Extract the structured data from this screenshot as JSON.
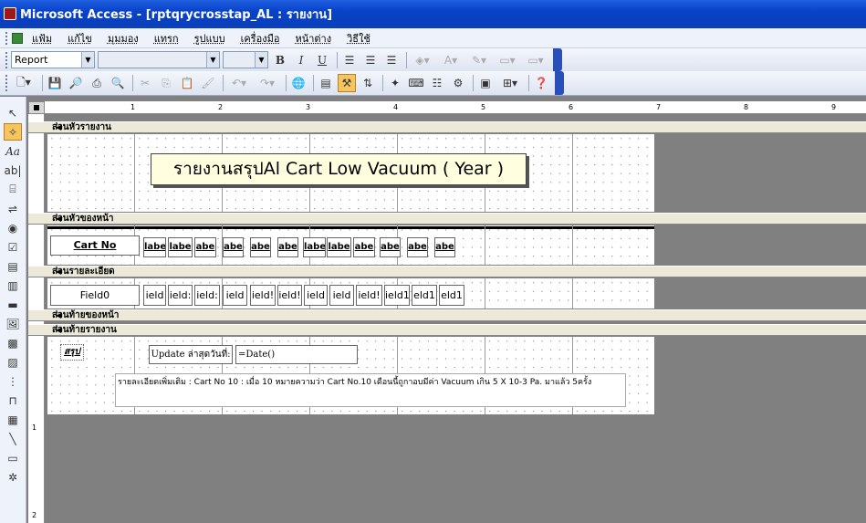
{
  "window": {
    "title": "Microsoft Access - [rptqrycrosstap_AL : รายงาน]"
  },
  "menu": [
    "แฟ้ม",
    "แก้ไข",
    "มุมมอง",
    "แทรก",
    "รูปแบบ",
    "เครื่องมือ",
    "หน้าต่าง",
    "วิธีใช้"
  ],
  "format_bar": {
    "object_combo": "Report",
    "font_combo": "",
    "size_combo": ""
  },
  "ruler": {
    "h": [
      "1",
      "2",
      "3",
      "4",
      "5",
      "6",
      "7",
      "8",
      "9"
    ],
    "v": [
      "1",
      "2"
    ]
  },
  "bands": {
    "report_header": "ส่วนหัวรายงาน",
    "page_header": "ส่วนหัวของหน้า",
    "detail": "ส่วนรายละเอียด",
    "page_footer": "ส่วนท้ายของหน้า",
    "report_footer": "ส่วนท้ายรายงาน"
  },
  "report": {
    "title": "รายงานสรุปAl Cart Low Vacuum ( Year )",
    "page_header_first": "Cart No",
    "page_header_labels": [
      "labe",
      "labe",
      "abe",
      "abe",
      "abe",
      "abe",
      "labe",
      "labe",
      "abe",
      "abe",
      "abe",
      "abe"
    ],
    "detail_first": "Field0",
    "detail_fields": [
      "ield",
      "ield:",
      "ield:",
      "ield",
      "ield!",
      "ield!",
      "ield",
      "ield",
      "ield!",
      "ield1",
      "eld1",
      "eld1"
    ],
    "footer_summary": "สรุป",
    "footer_update_label": "Update ล่าสุดวันที่:",
    "footer_update_value": "=Date()",
    "footer_note": "รายละเอียดเพิ่มเติม : Cart No 10 : เมื่อ 10 หมายความว่า Cart No.10 เดือนนี้ถูกาอบมีค่า Vacuum เกิน 5 X 10-3 Pa. มาแล้ว 5ครั้ง"
  },
  "toolbox_icons": [
    "pointer-icon",
    "wizard-icon",
    "label-icon",
    "textbox-icon",
    "option-group-icon",
    "toggle-icon",
    "option-icon",
    "checkbox-icon",
    "combo-icon",
    "list-icon",
    "button-icon",
    "image-icon",
    "unbound-frame-icon",
    "bound-frame-icon",
    "page-break-icon",
    "tab-icon",
    "subform-icon",
    "line-icon",
    "rectangle-icon",
    "more-tools-icon"
  ]
}
